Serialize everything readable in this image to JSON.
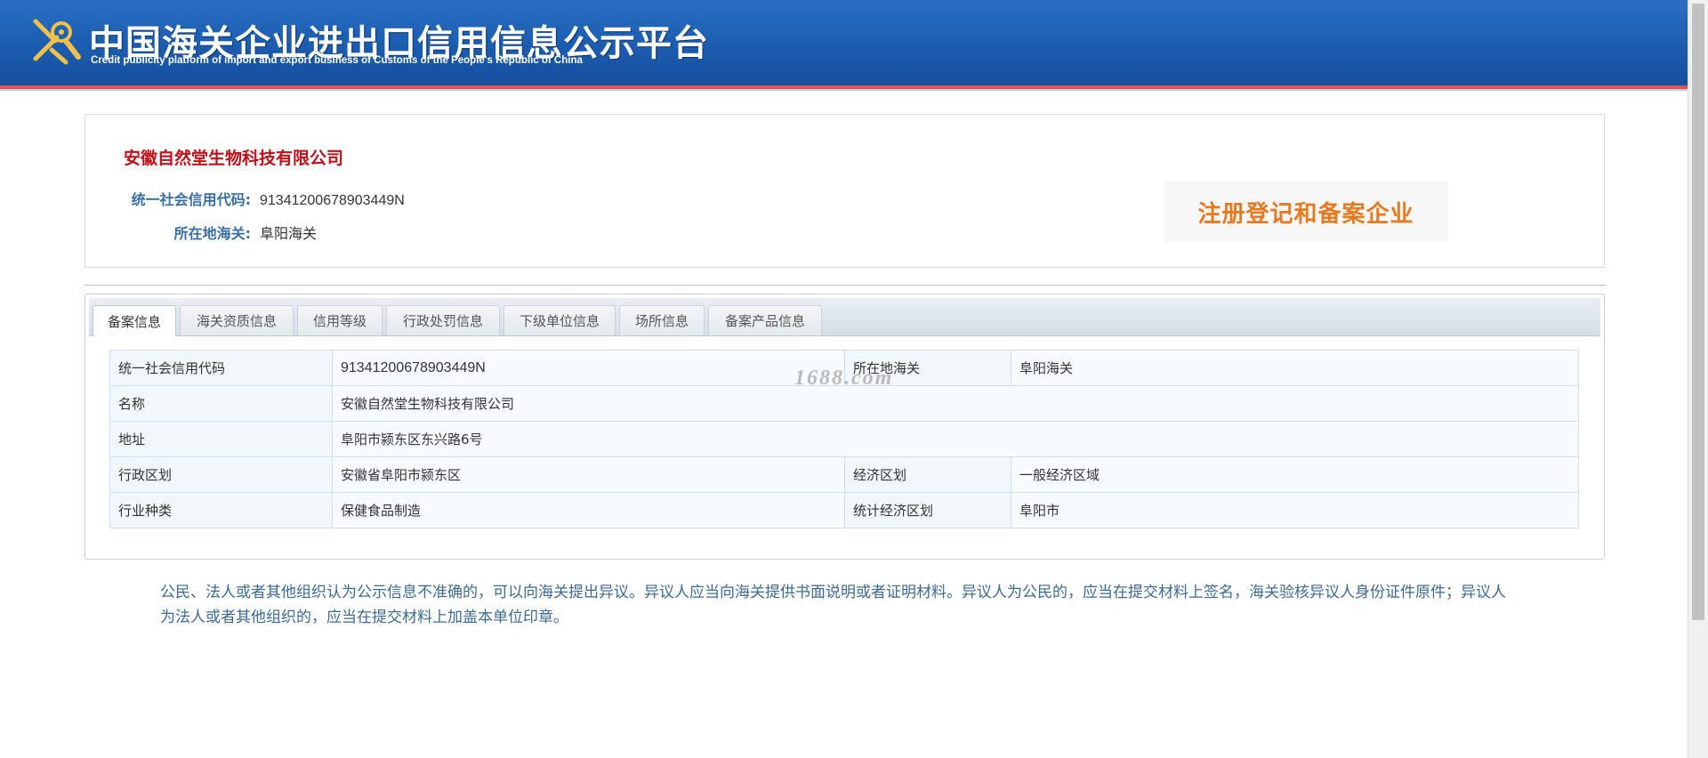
{
  "header": {
    "title": "中国海关企业进出口信用信息公示平台",
    "subtitle": "Credit publicity platform of import and export business of Customs of the People's Republic of China",
    "logo_icon": "customs-emblem-icon"
  },
  "company": {
    "name": "安徽自然堂生物科技有限公司",
    "credit_code_label": "统一社会信用代码:",
    "credit_code": "91341200678903449N",
    "customs_label": "所在地海关:",
    "customs": "阜阳海关",
    "stamp_text": "注册登记和备案企业"
  },
  "tabs": [
    {
      "label": "备案信息",
      "active": true
    },
    {
      "label": "海关资质信息"
    },
    {
      "label": "信用等级"
    },
    {
      "label": "行政处罚信息"
    },
    {
      "label": "下级单位信息"
    },
    {
      "label": "场所信息"
    },
    {
      "label": "备案产品信息"
    }
  ],
  "table": {
    "rows": [
      [
        "统一社会信用代码",
        "91341200678903449N",
        "所在地海关",
        "阜阳海关"
      ],
      [
        "名称",
        "安徽自然堂生物科技有限公司"
      ],
      [
        "地址",
        "阜阳市颍东区东兴路6号"
      ],
      [
        "行政区划",
        "安徽省阜阳市颍东区",
        "经济区划",
        "一般经济区域"
      ],
      [
        "行业种类",
        "保健食品制造",
        "统计经济区划",
        "阜阳市"
      ]
    ]
  },
  "watermark": "1688.com",
  "notice": "公民、法人或者其他组织认为公示信息不准确的，可以向海关提出异议。异议人应当向海关提供书面说明或者证明材料。异议人为公民的，应当在提交材料上签名，海关验核异议人身份证件原件；异议人为法人或者其他组织的，应当在提交材料上加盖本单位印章。",
  "colors": {
    "header_blue": "#1d5fb3",
    "company_red": "#c0101a",
    "label_blue": "#3a6ea5",
    "stamp_orange": "#e77a1f"
  }
}
